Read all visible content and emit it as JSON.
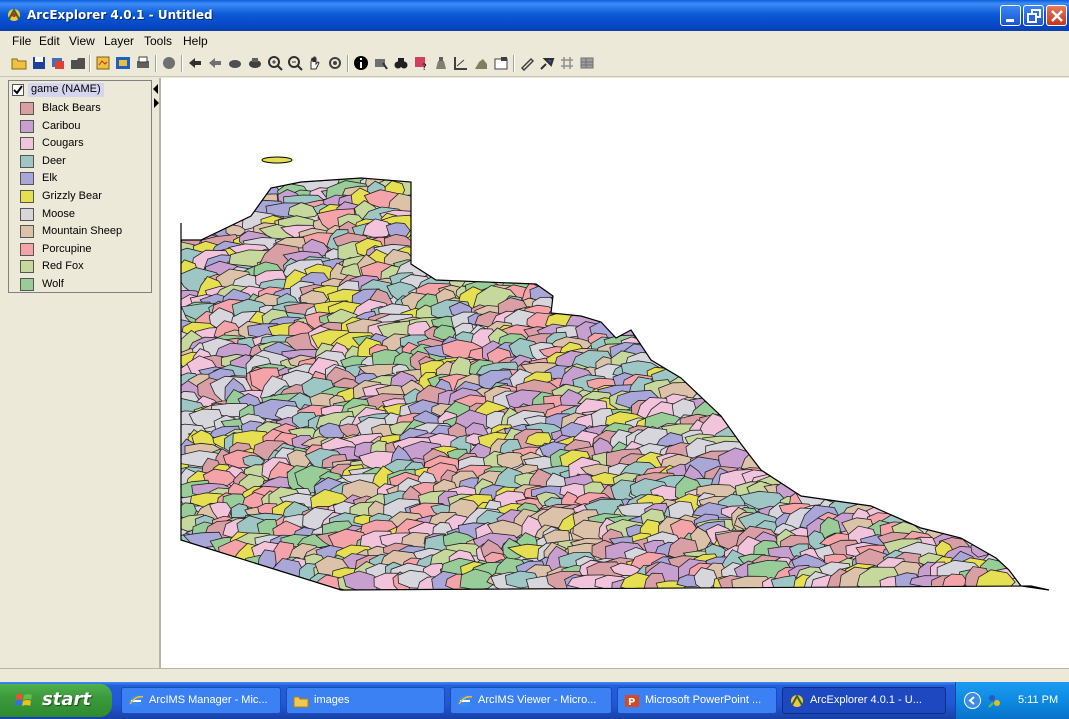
{
  "window": {
    "title": "ArcExplorer 4.0.1 - Untitled"
  },
  "menu": [
    "File",
    "Edit",
    "View",
    "Layer",
    "Tools",
    "Help"
  ],
  "toolbar": {
    "buttons": [
      "open-icon",
      "save-icon",
      "add-layer-icon",
      "open-folder-icon",
      "catalog-icon",
      "properties-icon",
      "print-icon",
      "stop-icon",
      "back-extent-icon",
      "previous-extent-icon",
      "zoom-full-icon",
      "zoom-layer-icon",
      "zoom-in-icon",
      "zoom-out-icon",
      "pan-icon",
      "refresh-icon",
      "identify-icon",
      "select-icon",
      "find-icon",
      "query-icon",
      "locate-icon",
      "measure-icon",
      "buffer-icon",
      "layer-properties-icon",
      "clear-icon",
      "hyperlink-icon",
      "grid-icon",
      "table-icon"
    ]
  },
  "legend": {
    "layer_name": "game (NAME)",
    "layer_checked": true,
    "items": [
      {
        "label": "Black Bears",
        "color": "#d8a0a4"
      },
      {
        "label": "Caribou",
        "color": "#c8a0d0"
      },
      {
        "label": "Cougars",
        "color": "#f2c4dc"
      },
      {
        "label": "Deer",
        "color": "#9ec6c4"
      },
      {
        "label": "Elk",
        "color": "#a9a6d8"
      },
      {
        "label": "Grizzly Bear",
        "color": "#e6df52"
      },
      {
        "label": "Moose",
        "color": "#d6d6dc"
      },
      {
        "label": "Mountain Sheep",
        "color": "#dcc2a8"
      },
      {
        "label": "Porcupine",
        "color": "#f4a4a8"
      },
      {
        "label": "Red Fox",
        "color": "#c6d89c"
      },
      {
        "label": "Wolf",
        "color": "#98cc98"
      }
    ]
  },
  "taskbar": {
    "start_label": "start",
    "tasks": [
      {
        "label": "ArcIMS Manager - Mic...",
        "icon": "ie-icon",
        "active": false
      },
      {
        "label": "images",
        "icon": "folder-icon",
        "active": false
      },
      {
        "label": "ArcIMS Viewer - Micro...",
        "icon": "ie-icon",
        "active": false
      },
      {
        "label": "Microsoft PowerPoint ...",
        "icon": "powerpoint-icon",
        "active": false
      },
      {
        "label": "ArcExplorer 4.0.1 - U...",
        "icon": "arcexplorer-icon",
        "active": true
      }
    ],
    "clock": "5:11 PM"
  }
}
